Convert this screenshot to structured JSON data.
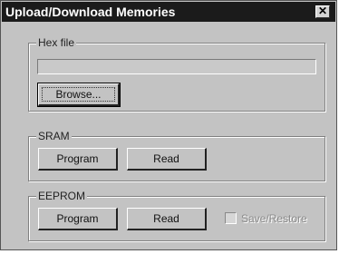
{
  "window": {
    "title": "Upload/Download Memories",
    "close_glyph": "✕"
  },
  "hex_file": {
    "group_label": "Hex file",
    "value": "",
    "browse_label": "Browse..."
  },
  "sram": {
    "group_label": "SRAM",
    "program_label": "Program",
    "read_label": "Read"
  },
  "eeprom": {
    "group_label": "EEPROM",
    "program_label": "Program",
    "read_label": "Read",
    "save_restore_label": "Save/Restore",
    "save_restore_checked": false,
    "save_restore_enabled": false
  },
  "colors": {
    "title_bar": "#1b1b1b",
    "dialog_bg": "#c3c3c3"
  }
}
